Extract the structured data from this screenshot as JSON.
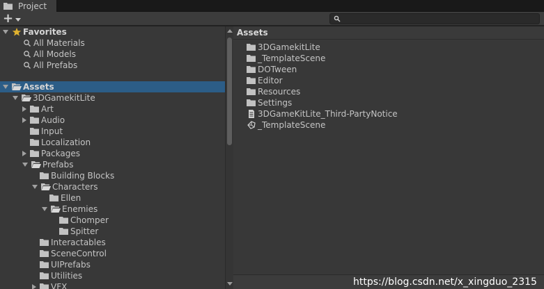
{
  "window": {
    "tab_label": "Project",
    "create_symbol": "+"
  },
  "search": {
    "placeholder": ""
  },
  "favorites": {
    "label": "Favorites",
    "items": [
      "All Materials",
      "All Models",
      "All Prefabs"
    ]
  },
  "tree": {
    "root": "Assets",
    "gamekit": "3DGamekitLite",
    "children": [
      "Art",
      "Audio",
      "Input",
      "Localization",
      "Packages",
      "Prefabs"
    ],
    "prefabs": [
      "Building Blocks",
      "Characters"
    ],
    "characters": [
      "Ellen",
      "Enemies"
    ],
    "enemies": [
      "Chomper",
      "Spitter"
    ],
    "prefabs_more": [
      "Interactables",
      "SceneControl",
      "UIPrefabs",
      "Utilities",
      "VFX"
    ]
  },
  "assets_panel": {
    "title": "Assets",
    "items": [
      {
        "label": "3DGamekitLite",
        "icon": "folder-icon"
      },
      {
        "label": "_TemplateScene",
        "icon": "folder-icon"
      },
      {
        "label": "DOTween",
        "icon": "folder-icon"
      },
      {
        "label": "Editor",
        "icon": "folder-icon"
      },
      {
        "label": "Resources",
        "icon": "folder-icon"
      },
      {
        "label": "Settings",
        "icon": "folder-icon"
      },
      {
        "label": "3DGameKitLite_Third-PartyNotice",
        "icon": "text-file-icon"
      },
      {
        "label": "_TemplateScene",
        "icon": "unity-scene-icon"
      }
    ]
  },
  "watermark": "https://blog.csdn.net/x_xingduo_2315",
  "colors": {
    "selection": "#2c5d87",
    "star": "#e0b22f",
    "folder": "#c2c2c2"
  }
}
